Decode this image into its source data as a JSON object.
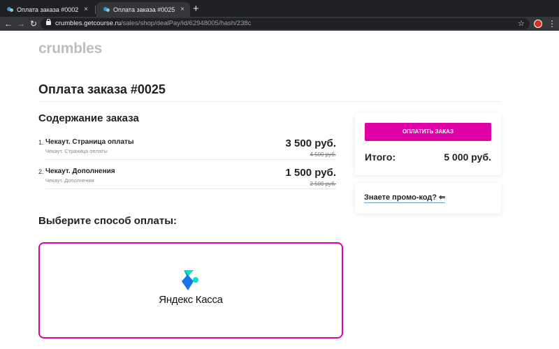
{
  "browser": {
    "tabs": [
      {
        "title": "Оплата заказа #0002",
        "active": false
      },
      {
        "title": "Оплата заказа #0025",
        "active": true
      }
    ],
    "new_tab": "+",
    "tab_close": "×",
    "url_host": "crumbles.getcourse.ru",
    "url_path": "/sales/shop/dealPay/id/62948005/hash/238c",
    "icons": {
      "back": "←",
      "forward": "→",
      "reload": "↻",
      "star": "☆",
      "menu": "⋮"
    }
  },
  "page": {
    "logo": "crumbles",
    "title": "Оплата заказа #0025",
    "order_section_title": "Содержание заказа",
    "items": [
      {
        "number": "1.",
        "name": "Чекаут. Страница оплаты",
        "subtitle": "Чекаут. Страница оплаты",
        "price": "3 500 руб.",
        "old_price": "4 500 руб."
      },
      {
        "number": "2.",
        "name": "Чекаут. Дополнения",
        "subtitle": "Чекаут. Дополнения",
        "price": "1 500 руб.",
        "old_price": "2 500 руб."
      }
    ],
    "pay_button": "ОПЛАТИТЬ ЗАКАЗ",
    "total_label": "Итого:",
    "total_value": "5 000 руб.",
    "promo_link": "Знаете промо-код?",
    "promo_arrow": "⇐",
    "payment_section_title": "Выберите способ оплаты:",
    "payment_method": "Яндекс Касса"
  },
  "colors": {
    "accent": "#e000a8",
    "yk_blue": "#1a73e8",
    "yk_green": "#00e6c3"
  }
}
